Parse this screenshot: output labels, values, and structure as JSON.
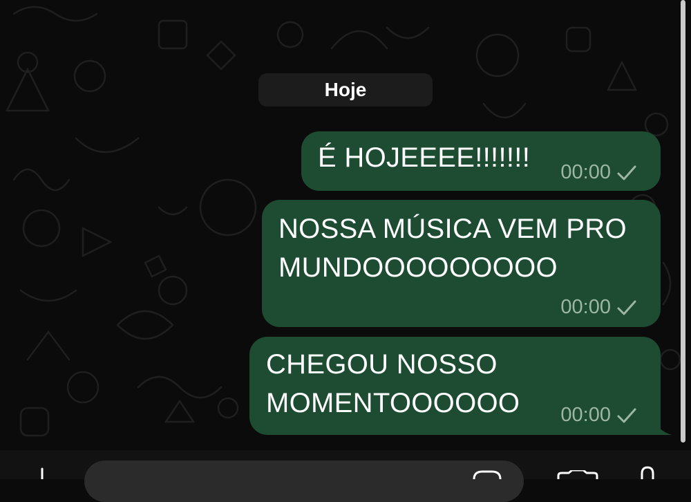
{
  "date_separator": "Hoje",
  "messages": [
    {
      "text": "É HOJEEEE!!!!!!!",
      "time": "00:00",
      "status": "sent-check-icon"
    },
    {
      "text_lines": [
        "NOSSA MÚSICA VEM PRO",
        "MUNDOOOOOOOOO"
      ],
      "time": "00:00",
      "status": "sent-check-icon"
    },
    {
      "text_lines": [
        "CHEGOU NOSSO",
        "MOMENTOOOOOO"
      ],
      "time": "00:00",
      "status": "sent-check-icon"
    }
  ],
  "composer": {
    "icons": [
      "plus-icon",
      "sticker-icon",
      "camera-icon",
      "microphone-icon"
    ]
  },
  "colors": {
    "background": "#0b0b0b",
    "outgoing_bubble": "#1d4c32",
    "date_pill": "#1c1c1c",
    "meta_text": "#9db6a5"
  }
}
